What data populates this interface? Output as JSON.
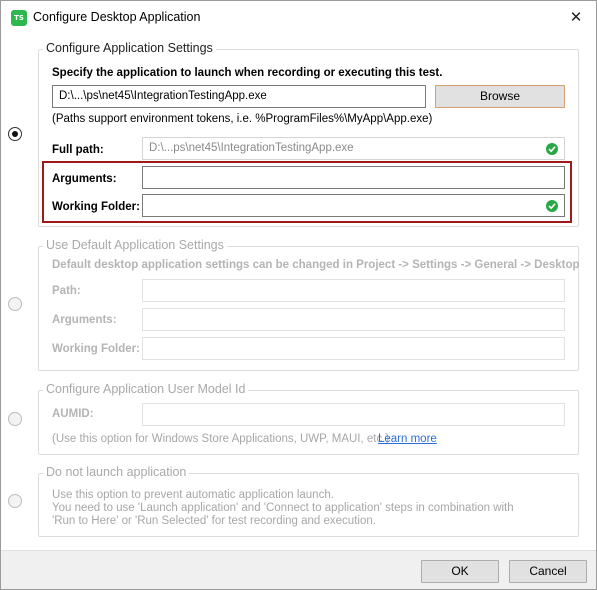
{
  "window": {
    "title": "Configure Desktop Application",
    "app_icon_text": "TS",
    "close_glyph": "✕"
  },
  "configure": {
    "legend": "Configure Application Settings",
    "instruction": "Specify the application to launch when recording or executing this test.",
    "path_value": "D:\\...\\ps\\net45\\IntegrationTestingApp.exe",
    "browse_label": "Browse",
    "note": "(Paths support environment tokens, i.e. %ProgramFiles%\\MyApp\\App.exe)",
    "full_path_label": "Full path:",
    "full_path_value": "D:\\...ps\\net45\\IntegrationTestingApp.exe",
    "arguments_label": "Arguments:",
    "arguments_value": "",
    "working_folder_label": "Working Folder:",
    "working_folder_value": ""
  },
  "default_settings": {
    "legend": "Use Default Application Settings",
    "info": "Default desktop application settings can be changed in Project -> Settings -> General -> Desktop",
    "path_label": "Path:",
    "arguments_label": "Arguments:",
    "working_folder_label": "Working Folder:"
  },
  "aumid": {
    "legend": "Configure Application User Model Id",
    "label": "AUMID:",
    "note": "(Use this option for Windows Store Applications, UWP, MAUI, etc.)",
    "link": "Learn more"
  },
  "no_launch": {
    "legend": "Do not launch application",
    "line1": "Use this option to prevent automatic application launch.",
    "line2": "You need to use 'Launch application' and 'Connect to application' steps in combination with",
    "line3": "'Run to Here' or 'Run Selected' for test recording and execution."
  },
  "footer": {
    "ok_label": "OK",
    "cancel_label": "Cancel"
  },
  "colors": {
    "accent_highlight": "#a01818",
    "check_green": "#28a745",
    "link_blue": "#2c6fd6"
  }
}
